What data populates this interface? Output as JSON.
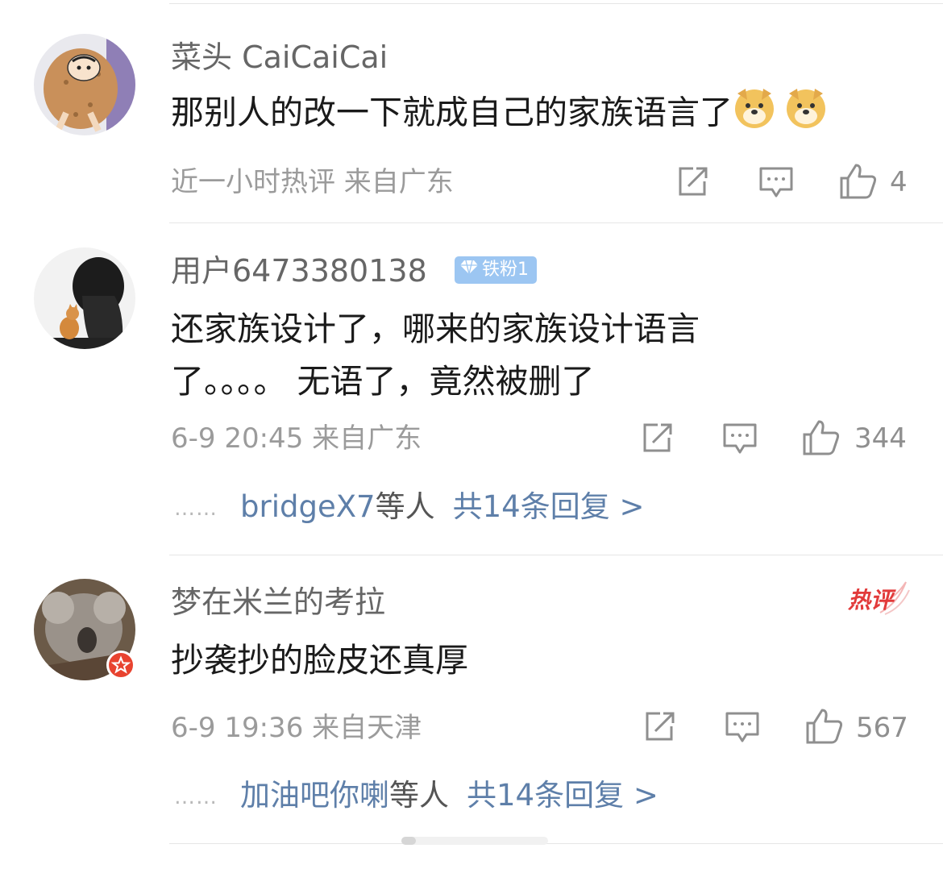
{
  "comments": [
    {
      "username": "菜头 CaiCaiCai",
      "text": "那别人的改一下就成自己的家族语言了",
      "emoji_icons": [
        "doge-emoji",
        "doge-emoji"
      ],
      "meta": "近一小时热评  来自广东",
      "likes": "4"
    },
    {
      "username": "用户6473380138",
      "badge": "铁粉1",
      "text_line1": "还家族设计了，哪来的家族设计语言",
      "text_line2": "了。。。。 无语了，竟然被删了",
      "meta": "6-9 20:45  来自广东",
      "likes": "344",
      "replies": {
        "dots": "……",
        "name": "bridgeX7",
        "mid": "等人",
        "count": "共14条回复 >"
      }
    },
    {
      "username": "梦在米兰的考拉",
      "hot_label": "热评",
      "text": "抄袭抄的脸皮还真厚",
      "meta": "6-9 19:36  来自天津",
      "likes": "567",
      "replies": {
        "dots": "……",
        "name": "加油吧你喇",
        "mid": "等人",
        "count": "共14条回复 >"
      }
    }
  ],
  "icons": {
    "share": "share-icon",
    "comment": "comment-icon",
    "like": "thumbs-up-icon"
  },
  "colors": {
    "link": "#5e7fa9",
    "meta": "#9b9b9b",
    "hot": "#e23a3a",
    "badge": "#9cc6f2"
  }
}
